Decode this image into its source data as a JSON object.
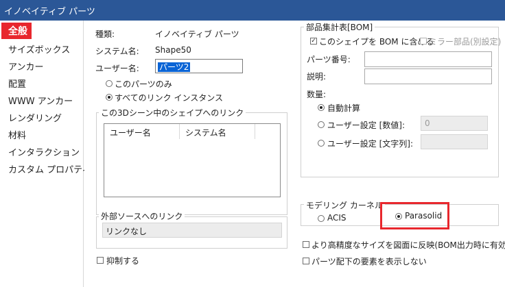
{
  "window": {
    "title": "イノベイティブ パーツ"
  },
  "sidebar": {
    "items": [
      {
        "label": "全般",
        "selected": true
      },
      {
        "label": "サイズボックス"
      },
      {
        "label": "アンカー"
      },
      {
        "label": "配置"
      },
      {
        "label": "WWW アンカー"
      },
      {
        "label": "レンダリング"
      },
      {
        "label": "材料"
      },
      {
        "label": "インタラクション"
      },
      {
        "label": "カスタム プロパティ"
      }
    ]
  },
  "general": {
    "type_label": "種類:",
    "type_value": "イノベイティブ パーツ",
    "system_name_label": "システム名:",
    "system_name_value": "Shape50",
    "user_name_label": "ユーザー名:",
    "user_name_value": "パーツ2",
    "radio_this_part": "このパーツのみ",
    "radio_all_links": "すべてのリンク インスタンス",
    "links_group_label": "この3Dシーン中のシェイプへのリンク",
    "links_columns": [
      "ユーザー名",
      "システム名"
    ],
    "external_group_label": "外部ソースへのリンク",
    "external_value": "リンクなし",
    "suppress_label": "抑制する"
  },
  "bom": {
    "group_label": "部品集計表[BOM]",
    "include_label": "このシェイプを BOM に含める",
    "include_checked": true,
    "mirror_label": "ミラー部品(別設定)",
    "part_number_label": "パーツ番号:",
    "description_label": "説明:",
    "quantity_label": "数量:",
    "auto_calc_label": "自動計算",
    "user_numeric_label": "ユーザー設定 [数値]:",
    "user_numeric_value": "0",
    "user_string_label": "ユーザー設定 [文字列]:"
  },
  "kernel": {
    "group_label": "モデリング カーネル",
    "acis_label": "ACIS",
    "parasolid_label": "Parasolid",
    "selected": "Parasolid"
  },
  "options": {
    "reflect_label": "より高精度なサイズを図面に反映(BOM出力時に有効)",
    "hide_children_label": "パーツ配下の要素を表示しない"
  },
  "colors": {
    "titlebar": "#2b5797",
    "highlight": "#e8272d",
    "selection": "#0a64d6"
  }
}
